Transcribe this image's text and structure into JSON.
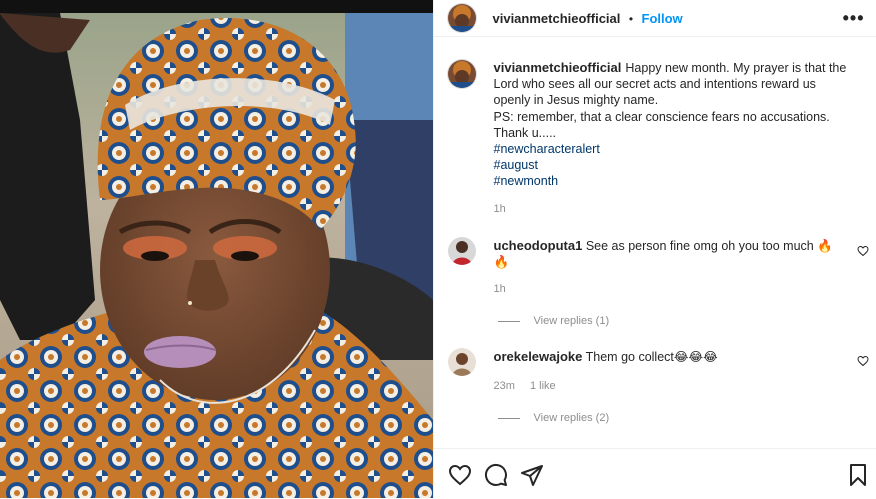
{
  "header": {
    "username": "vivianmetchieofficial",
    "separator": "•",
    "follow_label": "Follow",
    "more_label": "•••"
  },
  "caption": {
    "username": "vivianmetchieofficial",
    "text": "Happy new month. My prayer is that the Lord who sees all our secret acts and intentions reward us openly in Jesus mighty name.",
    "ps": "PS: remember, that a clear conscience fears no accusations.",
    "thanks": "Thank u.....",
    "hashtags": [
      "#newcharacteralert",
      "#august",
      "#newmonth"
    ],
    "time": "1h"
  },
  "comments": [
    {
      "username": "ucheodoputa1",
      "text": "See as person fine omg oh you too much 🔥🔥",
      "time": "1h",
      "likes": "",
      "view_replies": "View replies (1)"
    },
    {
      "username": "orekelewajoke",
      "text": "Them go collect😂😂😂",
      "time": "23m",
      "likes": "1 like",
      "view_replies": "View replies (2)"
    }
  ],
  "actions": {
    "like_icon": "heart-icon",
    "comment_icon": "comment-icon",
    "share_icon": "share-icon",
    "save_icon": "bookmark-icon"
  },
  "colors": {
    "link_blue": "#0095f6",
    "hashtag": "#00376b",
    "muted": "#8e8e8e",
    "text": "#262626"
  }
}
